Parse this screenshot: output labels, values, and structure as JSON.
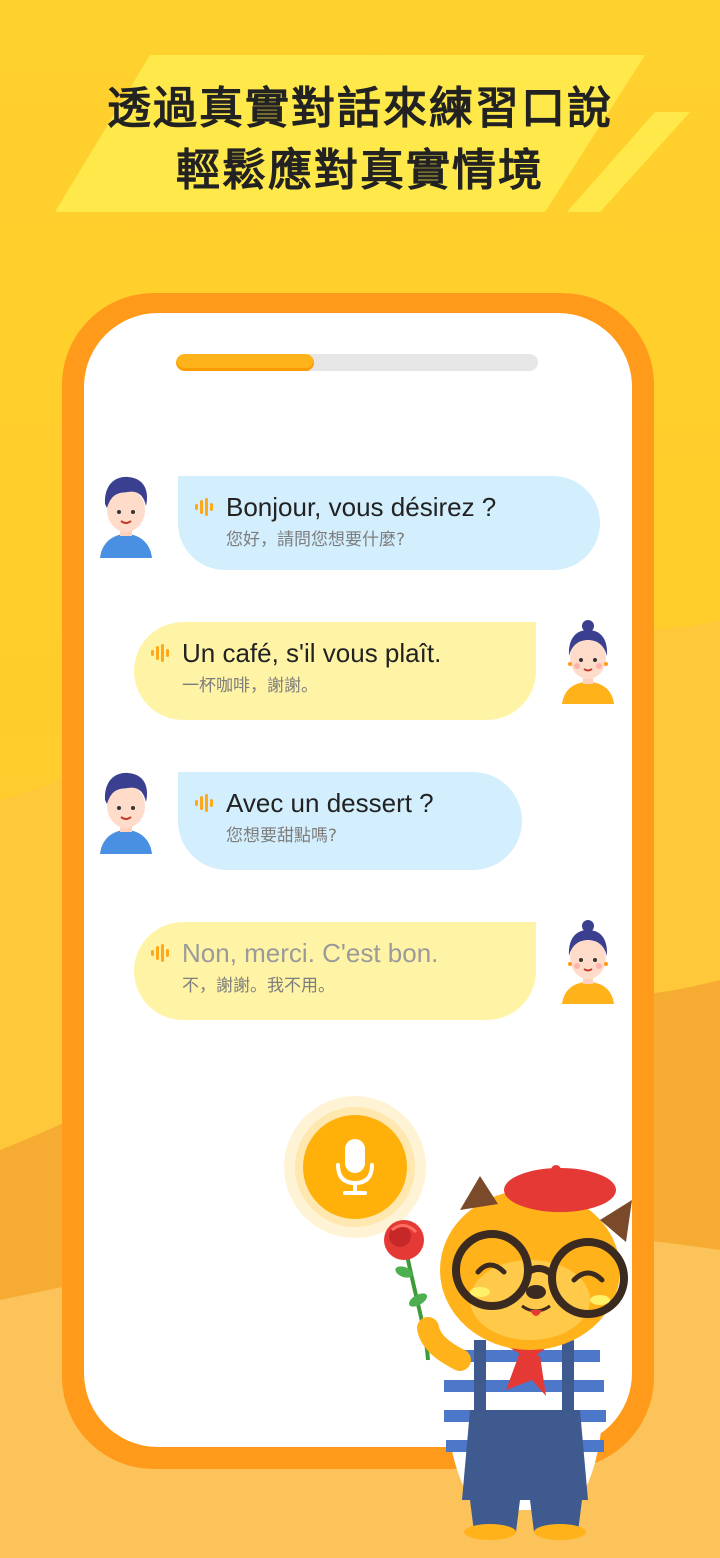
{
  "headline": {
    "line1": "透過真實對話來練習口說",
    "line2": "輕鬆應對真實情境"
  },
  "progress": {
    "fraction": 0.38
  },
  "conversation": [
    {
      "speaker": "waiter",
      "side": "left",
      "text": "Bonjour, vous désirez ?",
      "translation": "您好，請問您想要什麼?"
    },
    {
      "speaker": "customer",
      "side": "right",
      "text": "Un café, s'il vous plaît.",
      "translation": "一杯咖啡，謝謝。"
    },
    {
      "speaker": "waiter",
      "side": "left",
      "text": "Avec un dessert ?",
      "translation": "您想要甜點嗎?"
    },
    {
      "speaker": "customer",
      "side": "right",
      "text": "Non, merci. C'est bon.",
      "translation": "不，謝謝。我不用。",
      "pending": true
    }
  ],
  "colors": {
    "background": "#ffd12e",
    "phone_frame": "#ff9a1a",
    "bubble_left": "#d3eefc",
    "bubble_right": "#fff4a6",
    "mic_button": "#ffb10a"
  },
  "icons": {
    "audio": "sound-wave-icon",
    "record": "microphone-icon"
  }
}
